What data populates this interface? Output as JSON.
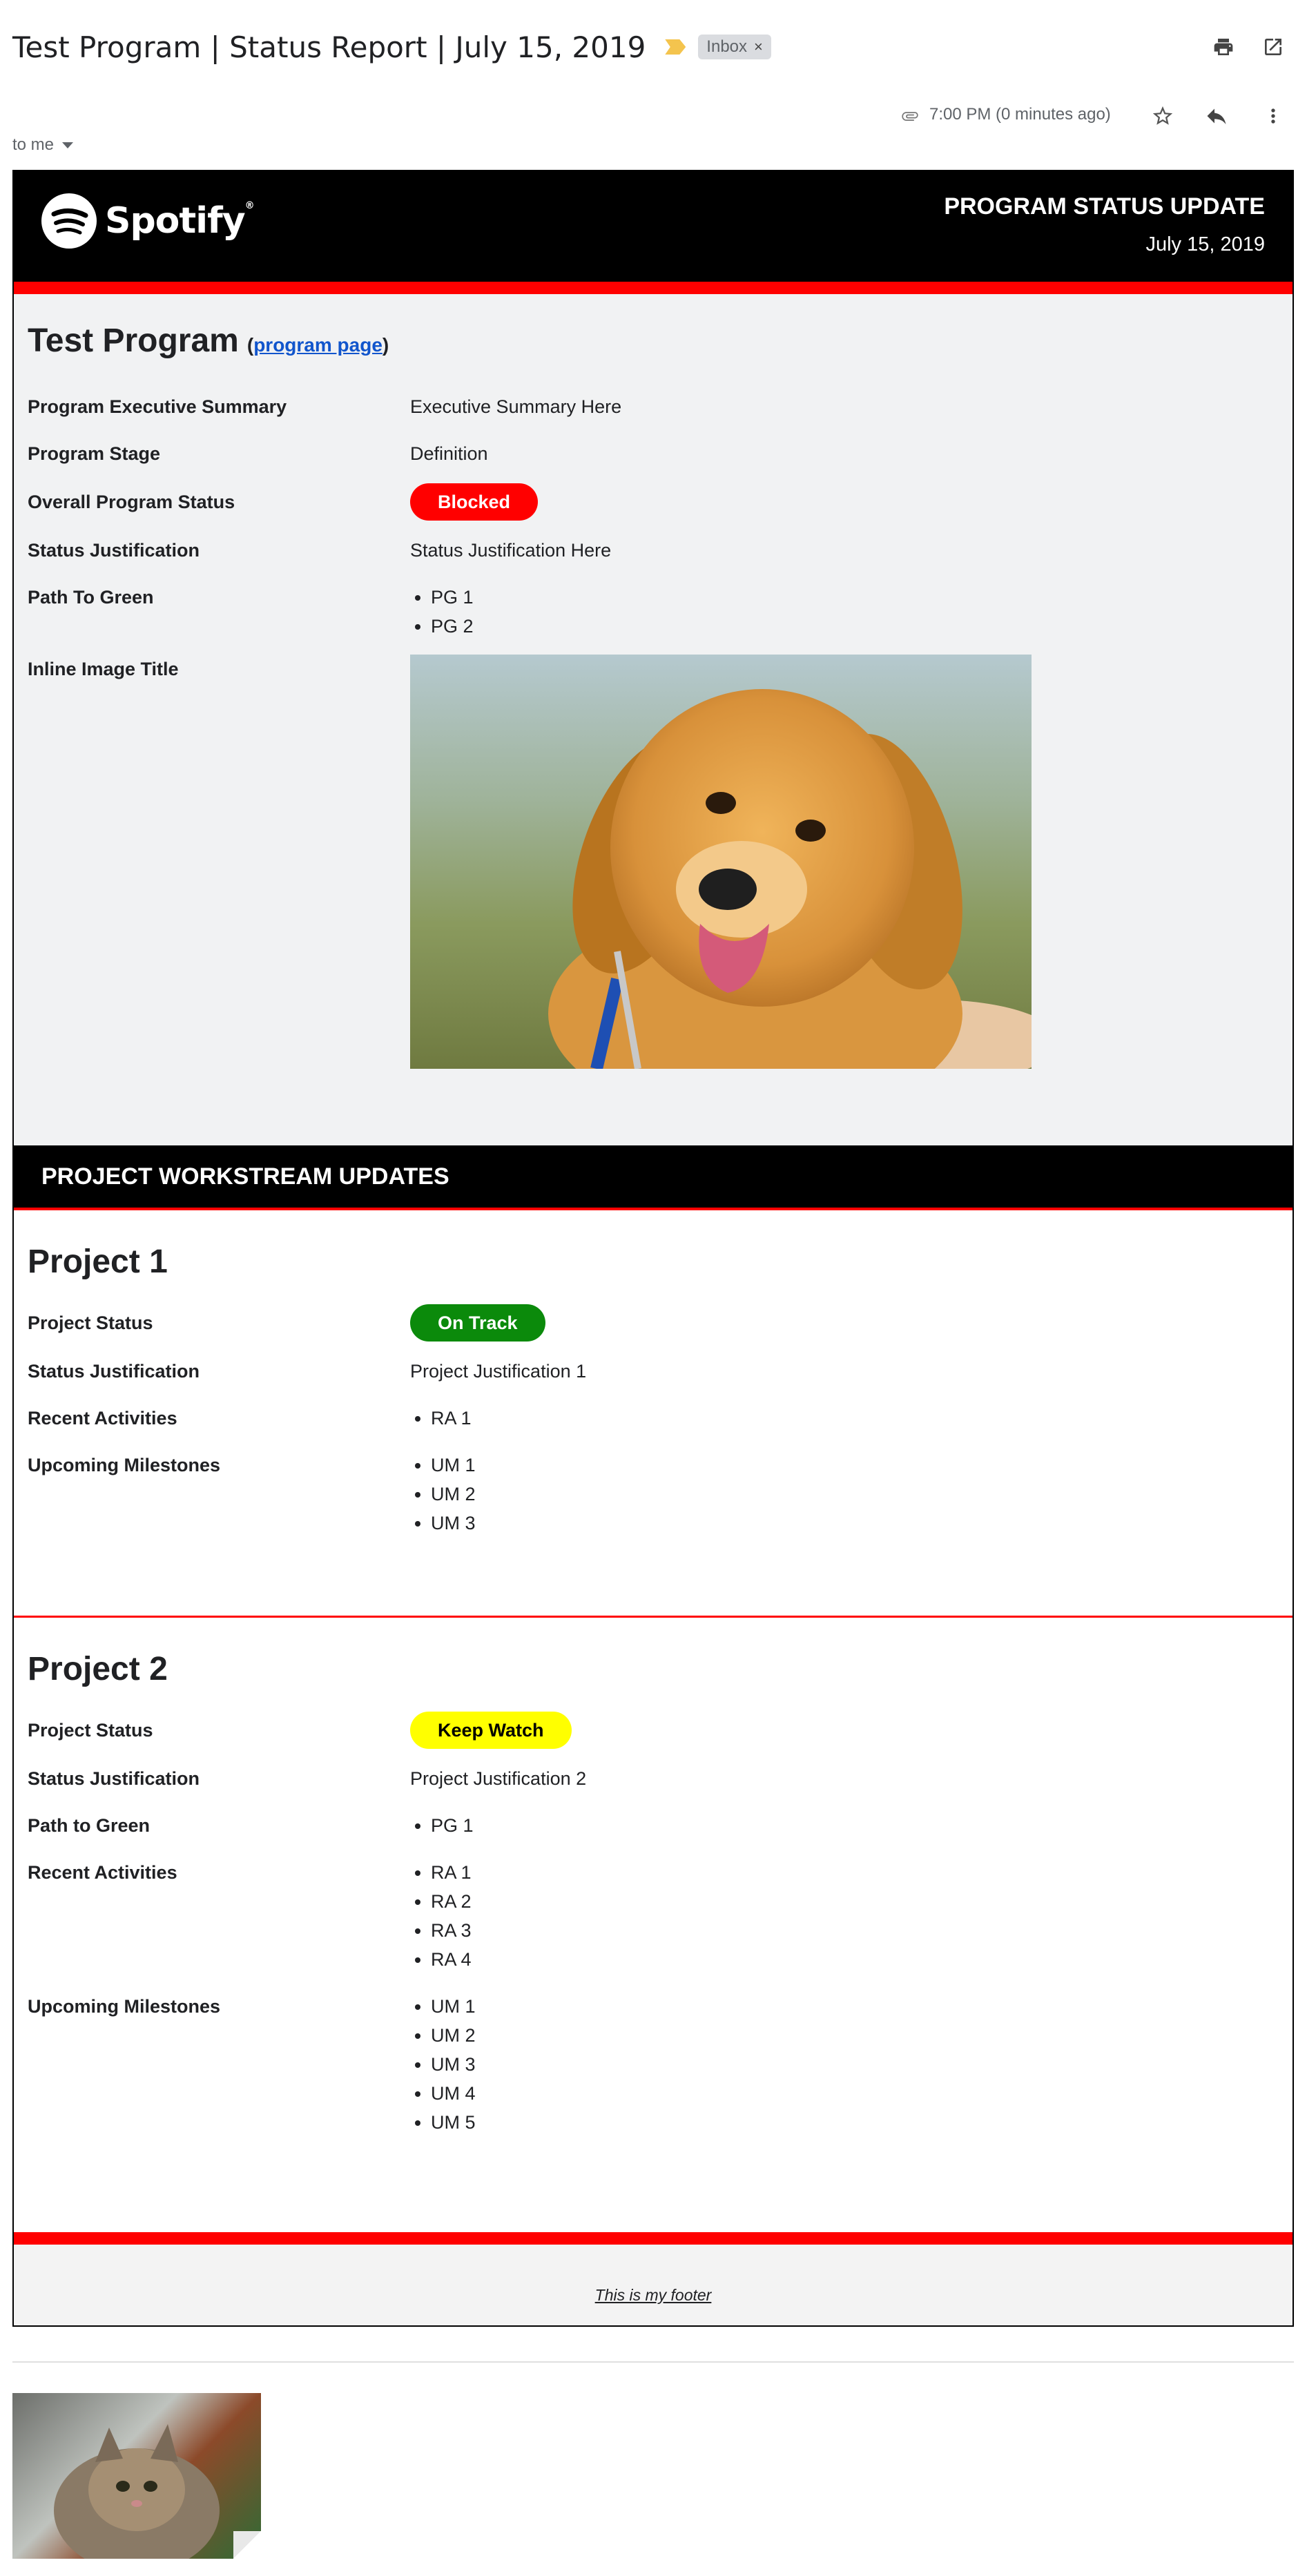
{
  "gmail": {
    "subject": "Test Program | Status Report | July 15, 2019",
    "label": "Inbox",
    "label_close": "×",
    "time": "7:00 PM (0 minutes ago)",
    "recipient": "to me",
    "icons": [
      "print-icon",
      "open-in-new-window-icon",
      "attachment-icon",
      "star-icon",
      "reply-icon",
      "more-vert-icon",
      "importance-marker-icon"
    ]
  },
  "banner": {
    "brand": "Spotify",
    "brand_tm": "®",
    "title": "PROGRAM STATUS UPDATE",
    "date": "July 15, 2019"
  },
  "program": {
    "title": "Test Program",
    "link_open": "(",
    "link_text": "program page",
    "link_close": ")",
    "rows": {
      "executive_summary": {
        "label": "Program Executive Summary",
        "value": "Executive Summary Here"
      },
      "stage": {
        "label": "Program Stage",
        "value": "Definition"
      },
      "overall_status": {
        "label": "Overall Program Status",
        "value": "Blocked",
        "color": "#ff0000"
      },
      "status_justification": {
        "label": "Status Justification",
        "value": "Status Justification Here"
      },
      "path_to_green": {
        "label": "Path To Green",
        "items": [
          "PG 1",
          "PG 2"
        ]
      },
      "inline_image": {
        "label": "Inline Image Title"
      }
    }
  },
  "workstream": {
    "header": "PROJECT WORKSTREAM UPDATES"
  },
  "projects": [
    {
      "title": "Project 1",
      "status_label": "Project Status",
      "status": "On Track",
      "status_color": "#0b8a0b",
      "justification_label": "Status Justification",
      "justification": "Project Justification 1",
      "recent_label": "Recent Activities",
      "recent": [
        "RA 1"
      ],
      "milestones_label": "Upcoming Milestones",
      "milestones": [
        "UM 1",
        "UM 2",
        "UM 3"
      ]
    },
    {
      "title": "Project 2",
      "status_label": "Project Status",
      "status": "Keep Watch",
      "status_color": "#ffff00",
      "justification_label": "Status Justification",
      "justification": "Project Justification 2",
      "path_label": "Path to Green",
      "path": [
        "PG 1"
      ],
      "recent_label": "Recent Activities",
      "recent": [
        "RA 1",
        "RA 2",
        "RA 3",
        "RA 4"
      ],
      "milestones_label": "Upcoming Milestones",
      "milestones": [
        "UM 1",
        "UM 2",
        "UM 3",
        "UM 4",
        "UM 5"
      ]
    }
  ],
  "footer": {
    "text": "This is my footer"
  },
  "colors": {
    "accent_red": "#ff0000",
    "banner_black": "#000000",
    "section_gray": "#f1f2f3",
    "link_blue": "#1155cc"
  }
}
